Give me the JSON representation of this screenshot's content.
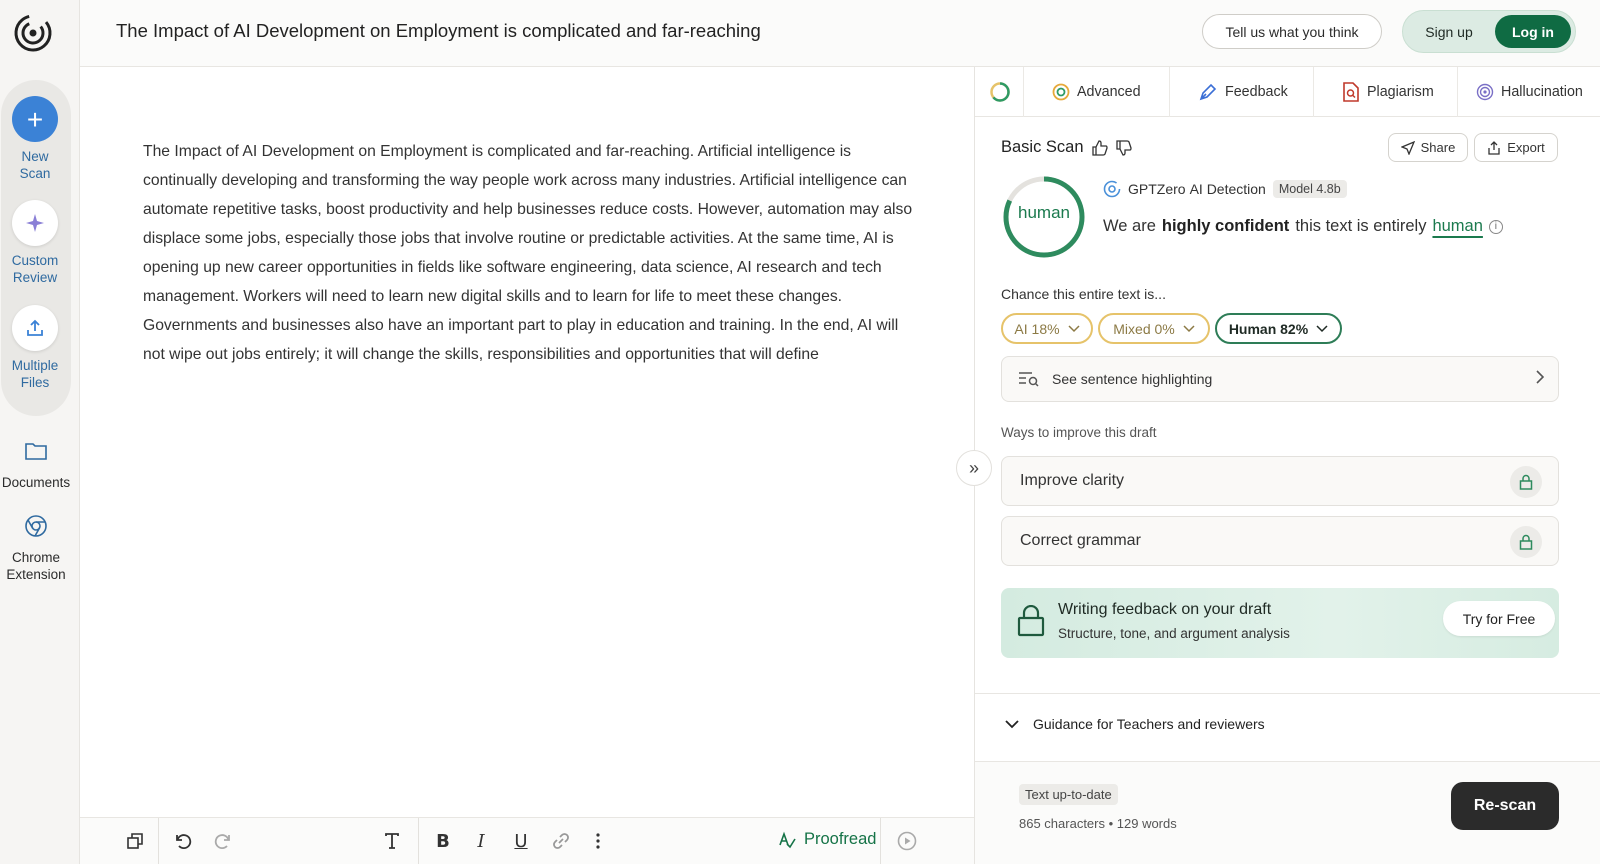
{
  "header": {
    "title": "The Impact of AI Development on Employment is complicated and far-reaching",
    "feedback_label": "Tell us what you think",
    "signup_label": "Sign up",
    "login_label": "Log in"
  },
  "sidebar": {
    "new_scan": [
      "New",
      "Scan"
    ],
    "custom_review": [
      "Custom",
      "Review"
    ],
    "multiple_files": [
      "Multiple",
      "Files"
    ],
    "documents": "Documents",
    "chrome_extension": [
      "Chrome",
      "Extension"
    ]
  },
  "editor": {
    "text": "The Impact of AI Development on Employment is complicated and far-reaching. Artificial intelligence is continually developing and transforming the way people work across many industries. Artificial intelligence can automate repetitive tasks, boost productivity and help businesses reduce costs. However, automation may also displace some jobs, especially those jobs that involve routine or predictable activities. At the same time, AI is opening up new career opportunities in fields like software engineering, data science, AI research and tech management. Workers will need to learn new digital skills and to learn for life to meet these changes. Governments and businesses also have an important part to play in education and training. In the end, AI will not wipe out jobs entirely; it will change the skills, responsibilities and opportunities that will define"
  },
  "toolbar": {
    "proofread_label": "Proofread"
  },
  "panel": {
    "tabs": [
      "Advanced",
      "Feedback",
      "Plagiarism",
      "Hallucination"
    ],
    "scan_title": "Basic Scan",
    "share_label": "Share",
    "export_label": "Export",
    "ring_label": "human",
    "detector_name": "GPTZero",
    "detector_suffix": "AI Detection",
    "model_badge": "Model 4.8b",
    "verdict": {
      "prefix": "We are",
      "bold": "highly confident",
      "middle": "this text is entirely",
      "highlight": "human"
    },
    "chance_label": "Chance this entire text is...",
    "chips": {
      "ai": "AI 18%",
      "mixed": "Mixed 0%",
      "human": "Human 82%"
    },
    "percentages": {
      "ai": 18,
      "mixed": 0,
      "human": 82
    },
    "highlighting_label": "See sentence highlighting",
    "ways_label": "Ways to improve this draft",
    "improve_items": [
      "Improve clarity",
      "Correct grammar"
    ],
    "promo": {
      "title": "Writing feedback on your draft",
      "subtitle": "Structure, tone, and argument analysis",
      "button": "Try for Free"
    },
    "guidance_label": "Guidance for Teachers and reviewers",
    "status_badge": "Text up-to-date",
    "counts": "865 characters • 129 words",
    "rescan_label": "Re-scan"
  },
  "colors": {
    "accent_green": "#0f6b43",
    "human_green": "#1b7a4e",
    "ai_yellow": "#e6c36a",
    "primary_blue": "#3b82d6"
  }
}
